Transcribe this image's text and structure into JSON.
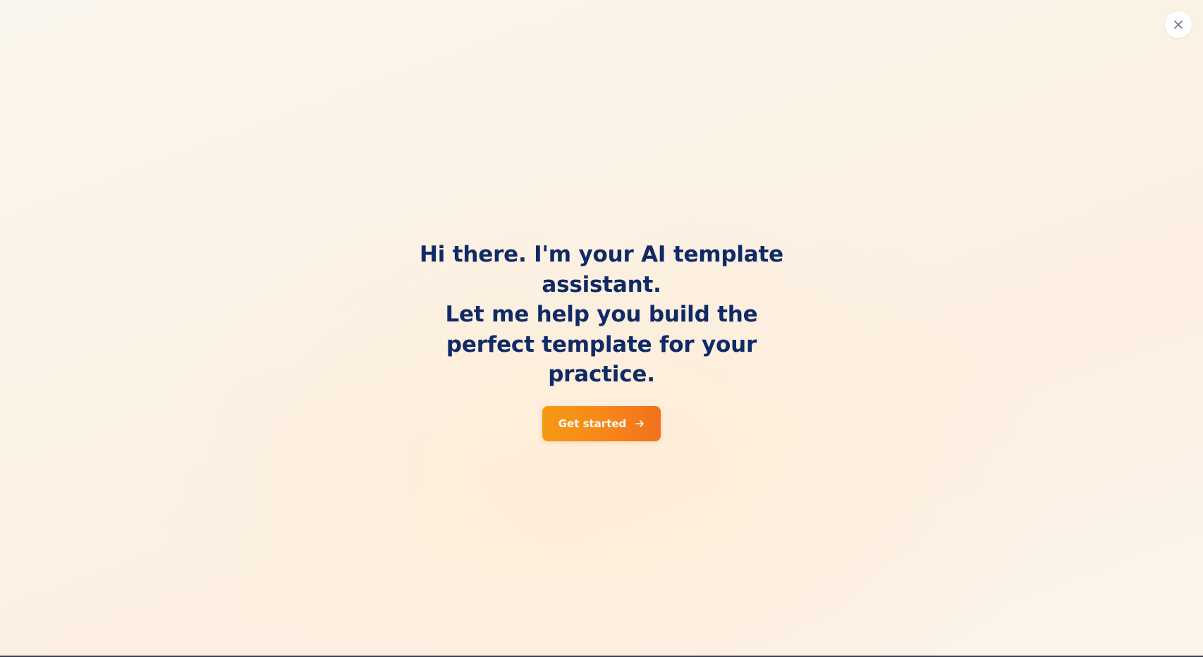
{
  "modal": {
    "close_label": "Close",
    "headline_line1": "Hi there. I'm your AI template assistant.",
    "headline_line2": "Let me help you build the perfect template for your practice.",
    "cta_label": "Get started"
  },
  "icons": {
    "close": "close-icon",
    "cta_arrow": "arrow-right-icon"
  },
  "colors": {
    "headline": "#0f2a66",
    "cta_start": "#f59a14",
    "cta_end": "#f2711d",
    "background": "#faf5ec"
  }
}
